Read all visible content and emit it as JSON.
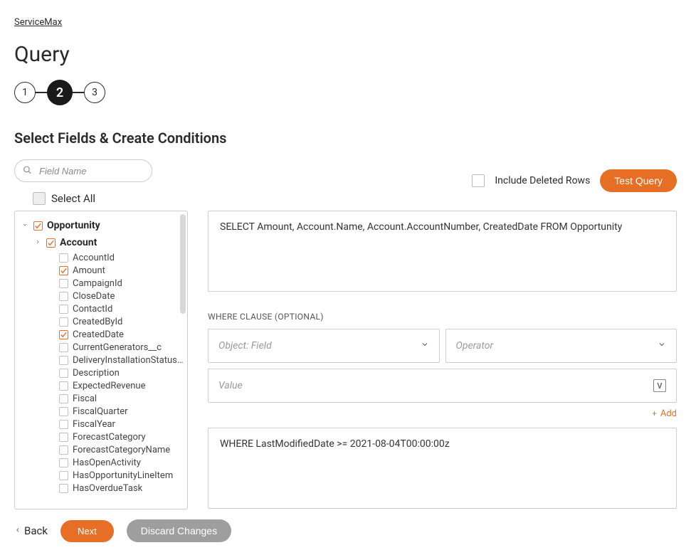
{
  "breadcrumb": "ServiceMax",
  "page_title": "Query",
  "stepper": {
    "steps": [
      "1",
      "2",
      "3"
    ],
    "active": 1
  },
  "section_title": "Select Fields & Create Conditions",
  "search": {
    "placeholder": "Field Name"
  },
  "include_deleted": {
    "label": "Include Deleted Rows",
    "checked": false
  },
  "test_query_label": "Test Query",
  "select_all": {
    "label": "Select All",
    "checked": false
  },
  "tree": {
    "root": {
      "label": "Opportunity",
      "checked": true,
      "expanded": true
    },
    "child": {
      "label": "Account",
      "checked": true,
      "expanded": false
    },
    "fields": [
      {
        "label": "AccountId",
        "checked": false
      },
      {
        "label": "Amount",
        "checked": true
      },
      {
        "label": "CampaignId",
        "checked": false
      },
      {
        "label": "CloseDate",
        "checked": false
      },
      {
        "label": "ContactId",
        "checked": false
      },
      {
        "label": "CreatedById",
        "checked": false
      },
      {
        "label": "CreatedDate",
        "checked": true
      },
      {
        "label": "CurrentGenerators__c",
        "checked": false
      },
      {
        "label": "DeliveryInstallationStatus...",
        "checked": false
      },
      {
        "label": "Description",
        "checked": false
      },
      {
        "label": "ExpectedRevenue",
        "checked": false
      },
      {
        "label": "Fiscal",
        "checked": false
      },
      {
        "label": "FiscalQuarter",
        "checked": false
      },
      {
        "label": "FiscalYear",
        "checked": false
      },
      {
        "label": "ForecastCategory",
        "checked": false
      },
      {
        "label": "ForecastCategoryName",
        "checked": false
      },
      {
        "label": "HasOpenActivity",
        "checked": false
      },
      {
        "label": "HasOpportunityLineItem",
        "checked": false
      },
      {
        "label": "HasOverdueTask",
        "checked": false
      }
    ]
  },
  "query_text": "SELECT Amount, Account.Name, Account.AccountNumber, CreatedDate FROM Opportunity",
  "where": {
    "title": "WHERE CLAUSE (OPTIONAL)",
    "object_field_placeholder": "Object: Field",
    "operator_placeholder": "Operator",
    "value_placeholder": "Value",
    "add_label": "Add",
    "result": "WHERE LastModifiedDate >= 2021-08-04T00:00:00z"
  },
  "footer": {
    "back": "Back",
    "next": "Next",
    "discard": "Discard Changes"
  },
  "colors": {
    "accent": "#e66e25"
  }
}
